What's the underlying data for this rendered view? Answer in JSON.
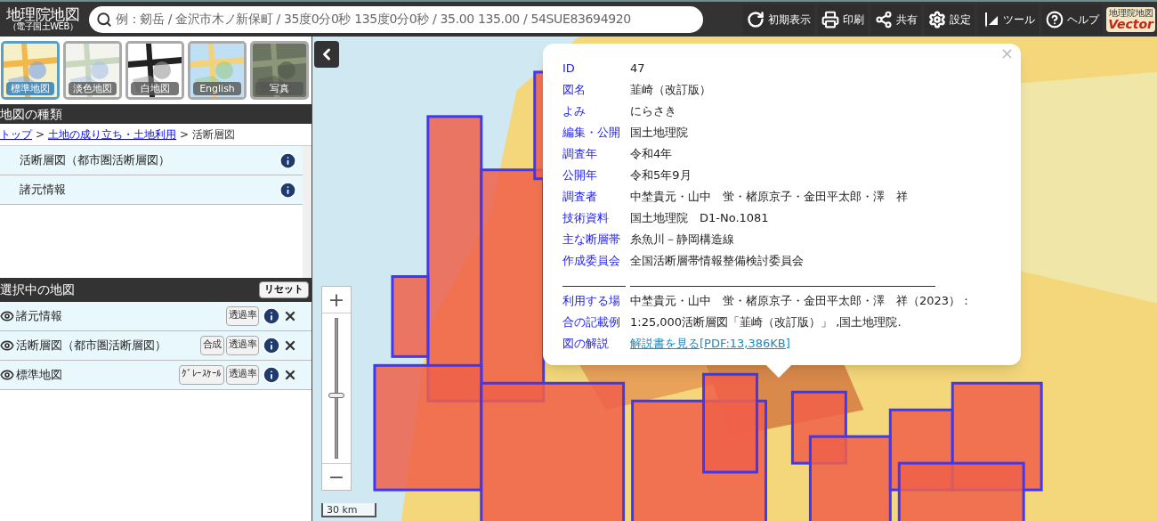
{
  "header": {
    "logo_title": "地理院地図",
    "logo_subtitle": "（電子国土WEB）",
    "search": {
      "placeholder": "例：剱岳 / 金沢市木ノ新保町 / 35度0分0秒 135度0分0秒 / 35.00 135.00 / 54SUE83694920"
    },
    "buttons": [
      {
        "kind": "reset",
        "label": "初期表示"
      },
      {
        "kind": "print",
        "label": "印刷"
      },
      {
        "kind": "share",
        "label": "共有"
      },
      {
        "kind": "settings",
        "label": "設定"
      },
      {
        "kind": "tools",
        "label": "ツール"
      },
      {
        "kind": "help",
        "label": "ヘルプ"
      }
    ],
    "vector_badge": {
      "top": "地理院地図",
      "bottom": "Vector"
    }
  },
  "basemaps": [
    {
      "label": "標準地図",
      "selected": true
    },
    {
      "label": "淡色地図",
      "selected": false
    },
    {
      "label": "白地図",
      "selected": false
    },
    {
      "label": "English",
      "selected": false
    },
    {
      "label": "写真",
      "selected": false
    }
  ],
  "map_types": {
    "title": "地図の種類",
    "separator": ">",
    "breadcrumb": [
      {
        "label": "トップ",
        "link": true
      },
      {
        "label": "土地の成り立ち・土地利用",
        "link": true
      },
      {
        "label": "活断層図",
        "link": false
      }
    ],
    "items": [
      {
        "label": "活断層図（都市圏活断層図）"
      },
      {
        "label": "諸元情報"
      }
    ]
  },
  "selected_maps": {
    "title": "選択中の地図",
    "reset": "リセット",
    "rows": [
      {
        "label": "諸元情報",
        "buttons": [
          "透過率"
        ]
      },
      {
        "label": "活断層図（都市圏活断層図）",
        "buttons": [
          "合成",
          "透過率"
        ]
      },
      {
        "label": "標準地図",
        "buttons": [
          "ｸﾞﾚｰｽｹｰﾙ",
          "透過率"
        ]
      }
    ]
  },
  "zoom_slider": {
    "level": 0.45,
    "plus": "+",
    "minus": "−"
  },
  "scale": "30 km",
  "popup": {
    "close": "×",
    "rows": [
      {
        "label": "ID",
        "value": "47"
      },
      {
        "label": "図名",
        "value": "韮崎（改訂版）"
      },
      {
        "label": "よみ",
        "value": "にらさき"
      },
      {
        "label": "編集・公開",
        "value": "国土地理院"
      },
      {
        "label": "調査年",
        "value": "令和4年"
      },
      {
        "label": "公開年",
        "value": "令和5年9月"
      },
      {
        "label": "調査者",
        "value": "中埜貴元・山中　蛍・楮原京子・金田平太郎・澤　祥"
      },
      {
        "label": "技術資料",
        "value": "国土地理院　D1-No.1081"
      },
      {
        "label": "主な断層帯",
        "value": "糸魚川－静岡構造線"
      },
      {
        "label": "作成委員会",
        "value": "全国活断層帯情報整備検討委員会"
      }
    ],
    "rows2": [
      {
        "label": "利用する場合の記載例",
        "value": "中埜貴元・山中　蛍・楮原京子・金田平太郎・澤　祥（2023）：1:25,000活断層図「韮崎（改訂版）」 ,国土地理院.",
        "link": false
      },
      {
        "label": "図の解説",
        "value": "解説書を見る[PDF:13,386KB]",
        "link": true
      }
    ]
  }
}
